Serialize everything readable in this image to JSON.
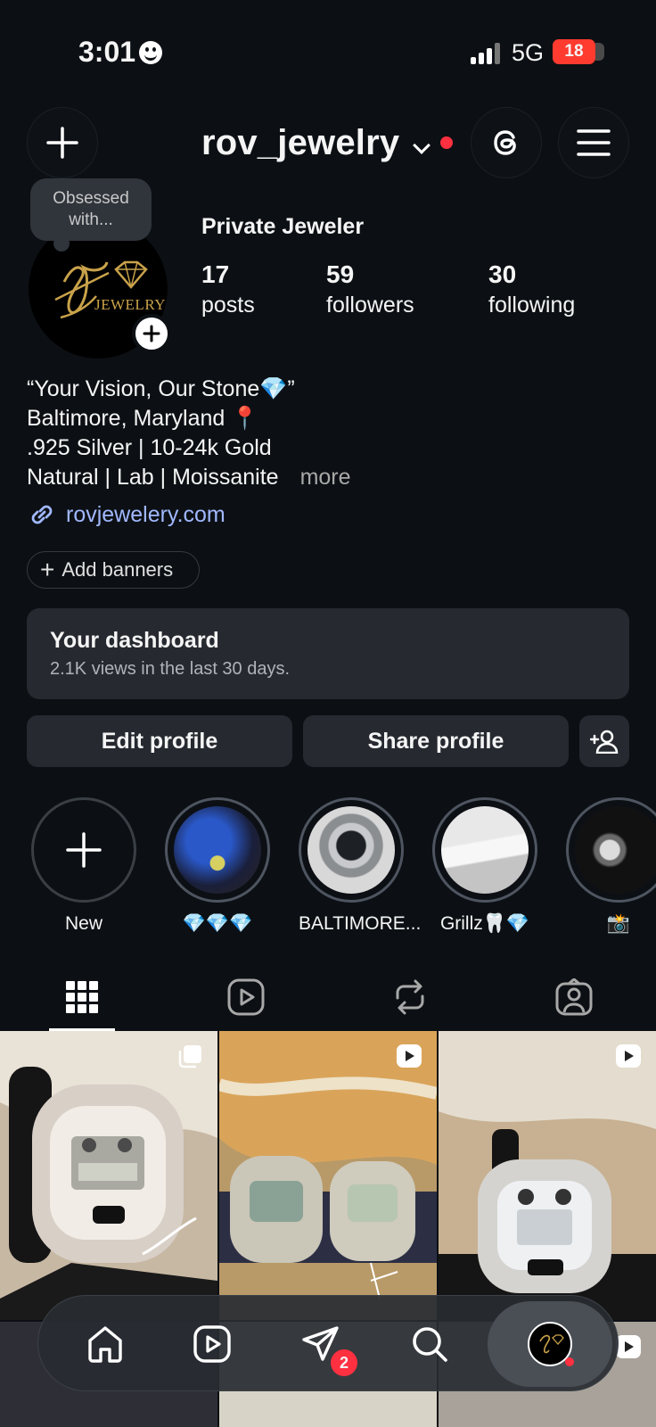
{
  "status": {
    "time": "3:01",
    "network": "5G",
    "battery": "18"
  },
  "header": {
    "username": "rov_jewelry"
  },
  "profile": {
    "note": "Obsessed with...",
    "avatar_text": "JEWELRY",
    "category": "Private Jeweler",
    "stats": [
      {
        "value": "17",
        "label": "posts"
      },
      {
        "value": "59",
        "label": "followers"
      },
      {
        "value": "30",
        "label": "following"
      }
    ],
    "bio": [
      "“Your Vision, Our Stone💎”",
      "Baltimore, Maryland 📍",
      ".925 Silver | 10-24k Gold",
      "Natural | Lab | Moissanite"
    ],
    "bio_more": "more",
    "link": "rovjewelery.com",
    "add_banners": "Add banners"
  },
  "dashboard": {
    "title": "Your dashboard",
    "subtitle": "2.1K views in the last 30 days."
  },
  "actions": {
    "edit": "Edit profile",
    "share": "Share profile"
  },
  "highlights": [
    {
      "label": "New"
    },
    {
      "label": "💎💎💎"
    },
    {
      "label": "BALTIMORE..."
    },
    {
      "label": "Grillz🦷💎"
    },
    {
      "label": "📸"
    }
  ],
  "nav": {
    "messages_badge": "2"
  },
  "colors": {
    "background": "#0c1014",
    "card": "#262a30",
    "link": "#a1b8ff",
    "notification": "#ff3040"
  },
  "icons": {
    "tabs": [
      "grid-icon",
      "reels-icon",
      "reposts-icon",
      "tagged-icon"
    ],
    "bottom_nav": [
      "home-icon",
      "reels-icon",
      "messages-icon",
      "search-icon",
      "profile-avatar"
    ]
  }
}
